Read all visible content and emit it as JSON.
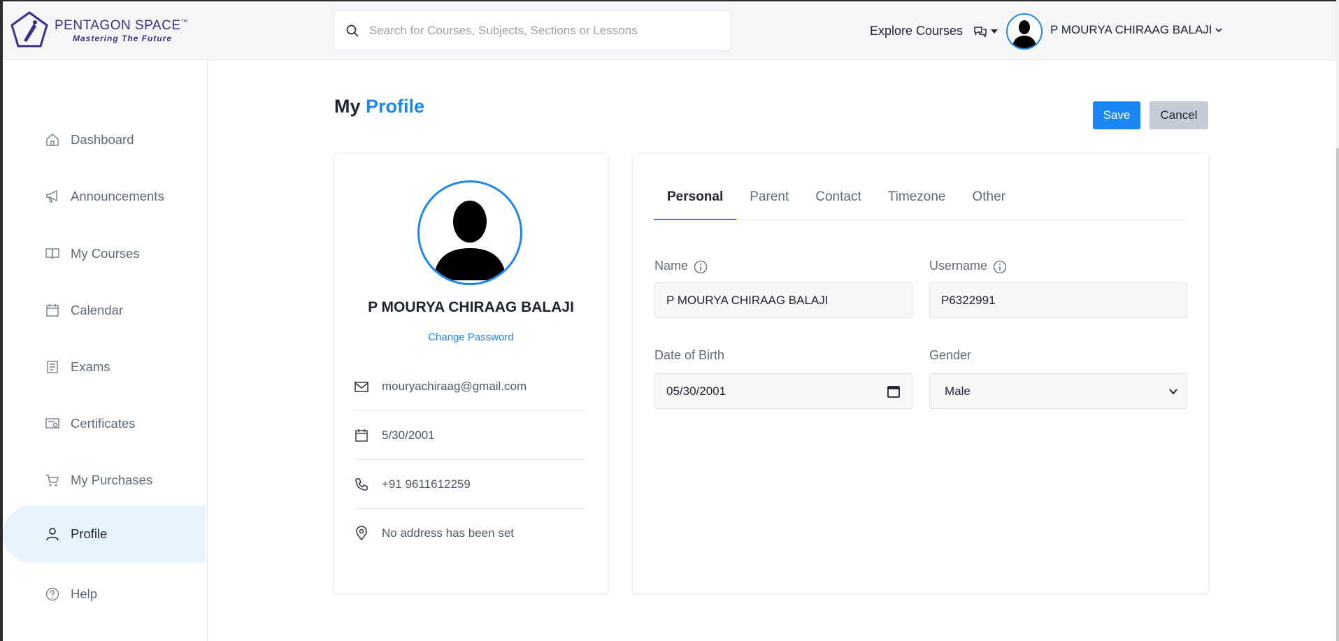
{
  "header": {
    "logo_title": "PENTAGON SPACE",
    "logo_tm": "™",
    "logo_tagline": "Mastering The Future",
    "search_placeholder": "Search for Courses, Subjects, Sections or Lessons",
    "explore_label": "Explore Courses",
    "user_name": "P MOURYA CHIRAAG BALAJI"
  },
  "sidebar": {
    "items": [
      {
        "label": "Dashboard",
        "icon": "home-icon"
      },
      {
        "label": "Announcements",
        "icon": "megaphone-icon"
      },
      {
        "label": "My Courses",
        "icon": "book-icon"
      },
      {
        "label": "Calendar",
        "icon": "calendar-icon"
      },
      {
        "label": "Exams",
        "icon": "exam-icon"
      },
      {
        "label": "Certificates",
        "icon": "certificate-icon"
      },
      {
        "label": "My Purchases",
        "icon": "cart-icon"
      },
      {
        "label": "Profile",
        "icon": "user-icon",
        "active": true
      },
      {
        "label": "Help",
        "icon": "help-icon"
      }
    ]
  },
  "page": {
    "title_part1": "My",
    "title_part2": "Profile",
    "save_label": "Save",
    "cancel_label": "Cancel"
  },
  "profile_card": {
    "name": "P MOURYA CHIRAAG BALAJI",
    "change_password": "Change Password",
    "email": "mouryachiraag@gmail.com",
    "dob": "5/30/2001",
    "phone": "+91 9611612259",
    "address": "No address has been set"
  },
  "tabs": [
    "Personal",
    "Parent",
    "Contact",
    "Timezone",
    "Other"
  ],
  "form": {
    "name_label": "Name",
    "name_value": "P MOURYA CHIRAAG BALAJI",
    "username_label": "Username",
    "username_value": "P6322991",
    "dob_label": "Date of Birth",
    "dob_value": "05/30/2001",
    "gender_label": "Gender",
    "gender_value": "Male"
  },
  "colors": {
    "accent": "#1c86f2",
    "brand": "#3a2f86",
    "active_nav_bg": "#e8f3fd"
  }
}
